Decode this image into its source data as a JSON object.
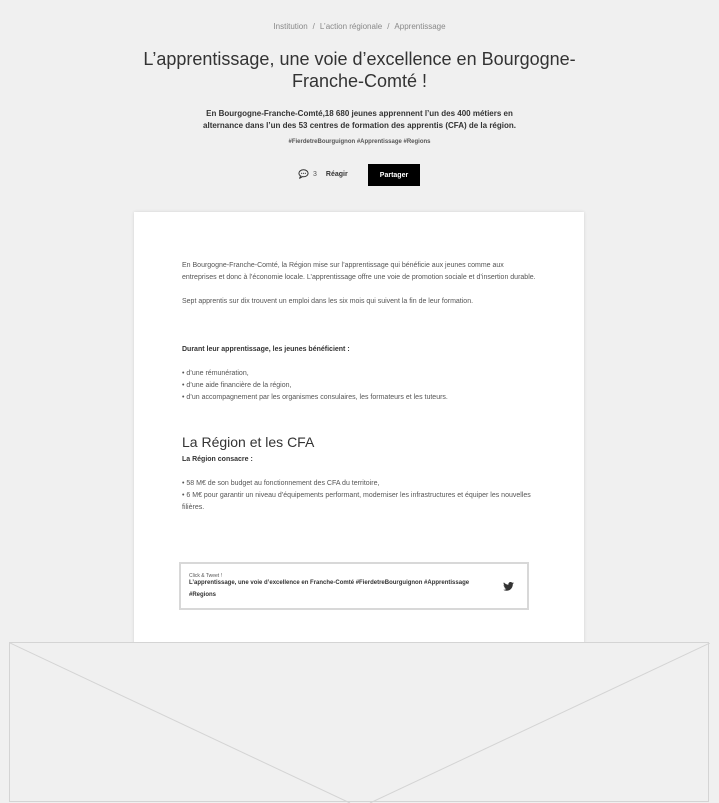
{
  "breadcrumb": {
    "items": [
      "Institution",
      "L’action régionale",
      "Apprentissage"
    ],
    "separator": "/"
  },
  "title": "L’apprentissage, une voie d’excellence en Bourgogne-Franche-Comté !",
  "summary": "En Bourgogne-Franche-Comté,18 680 jeunes apprennent l’un des 400 métiers en alternance dans l’un des 53 centres de formation des apprentis (CFA) de la région.",
  "hashtags": "#FierdetreBourguignon #Apprentissage #Regions",
  "actions": {
    "comment_count": "3",
    "react_label": "Réagir",
    "share_label": "Partager",
    "comment_icon": "speech-bubble-icon"
  },
  "article": {
    "intro": "En Bourgogne-Franche-Comté, la Région mise sur l’apprentissage qui bénéficie aux jeunes comme aux entreprises et donc à l’économie locale. L’apprentissage offre une voie de promotion sociale et d’insertion durable.",
    "stat": "Sept apprentis sur dix trouvent un emploi dans les six mois qui suivent la fin de leur formation.",
    "benefits_heading": "Durant leur apprentissage, les jeunes bénéficient :",
    "benefits": [
      "• d’une rémunération,",
      "• d’une aide financière de la région,",
      "• d’un accompagnement par les organismes consulaires, les formateurs et les tuteurs."
    ],
    "section_heading": "La Région et les CFA",
    "region_heading": "La Région consacre :",
    "region_items": [
      "• 58 M€ de son budget au fonctionnement des CFA du territoire,",
      "• 6 M€ pour garantir un niveau d’équipements performant, moderniser les infrastructures et équiper les nouvelles filières."
    ]
  },
  "click_to_tweet": {
    "label": "Click & Tweet !",
    "text": "L’apprentissage, une voie d’excellence en Franche-Comté #FierdetreBourguignon #Apprentissage #Regions",
    "icon": "twitter-bird-icon"
  },
  "colors": {
    "background": "#f0f0f0",
    "card": "#ffffff",
    "button": "#000000",
    "text": "#333333"
  }
}
